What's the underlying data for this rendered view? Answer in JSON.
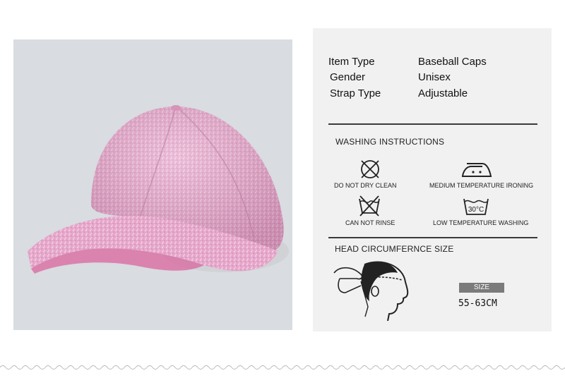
{
  "specs": [
    {
      "label": "Item Type",
      "value": "Baseball Caps"
    },
    {
      "label": "Gender",
      "value": "Unisex"
    },
    {
      "label": "Strap Type",
      "value": "Adjustable"
    }
  ],
  "washing": {
    "title": "WASHING INSTRUCTIONS",
    "items": [
      {
        "icon": "do-not-dry-clean-icon",
        "label": "DO NOT DRY CLEAN"
      },
      {
        "icon": "iron-icon",
        "label": "MEDIUM TEMPERATURE IRONING"
      },
      {
        "icon": "do-not-wash-icon",
        "label": "CAN NOT RINSE"
      },
      {
        "icon": "wash-tub-icon",
        "label": "LOW TEMPERATURE WASHING",
        "temp": "30°C"
      }
    ]
  },
  "head": {
    "title": "HEAD CIRCUMFERNCE SIZE",
    "size_label": "SIZE",
    "size_value": "55-63CM"
  },
  "colors": {
    "cap": "#e7a6cc",
    "panel": "#f1f1f1",
    "photo_bg": "#d9dce0",
    "badge": "#7b7b7b"
  }
}
